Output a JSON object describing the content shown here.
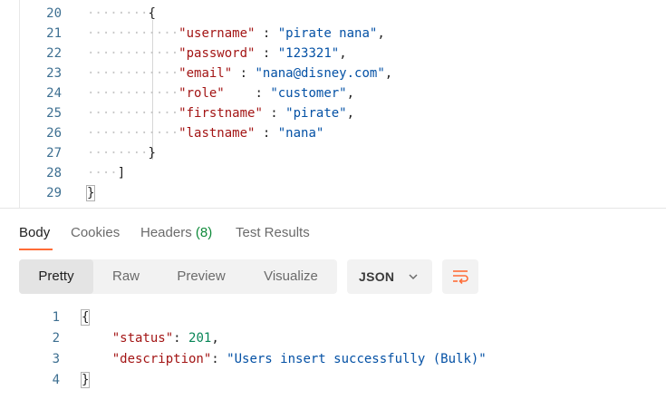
{
  "request_editor": {
    "lines": [
      {
        "n": "20",
        "indent": 8,
        "parts": [
          {
            "t": "{",
            "c": "p"
          }
        ]
      },
      {
        "n": "21",
        "indent": 12,
        "parts": [
          {
            "t": "\"username\"",
            "c": "k"
          },
          {
            "t": " : ",
            "c": "p"
          },
          {
            "t": "\"pirate nana\"",
            "c": "s"
          },
          {
            "t": ",",
            "c": "p"
          }
        ]
      },
      {
        "n": "22",
        "indent": 12,
        "parts": [
          {
            "t": "\"password\"",
            "c": "k"
          },
          {
            "t": " : ",
            "c": "p"
          },
          {
            "t": "\"123321\"",
            "c": "s"
          },
          {
            "t": ",",
            "c": "p"
          }
        ]
      },
      {
        "n": "23",
        "indent": 12,
        "parts": [
          {
            "t": "\"email\"",
            "c": "k"
          },
          {
            "t": " : ",
            "c": "p"
          },
          {
            "t": "\"nana@disney.com\"",
            "c": "s"
          },
          {
            "t": ",",
            "c": "p"
          }
        ]
      },
      {
        "n": "24",
        "indent": 12,
        "parts": [
          {
            "t": "\"role\"",
            "c": "k"
          },
          {
            "t": "    : ",
            "c": "p"
          },
          {
            "t": "\"customer\"",
            "c": "s"
          },
          {
            "t": ",",
            "c": "p"
          }
        ]
      },
      {
        "n": "25",
        "indent": 12,
        "parts": [
          {
            "t": "\"firstname\"",
            "c": "k"
          },
          {
            "t": " : ",
            "c": "p"
          },
          {
            "t": "\"pirate\"",
            "c": "s"
          },
          {
            "t": ",",
            "c": "p"
          }
        ]
      },
      {
        "n": "26",
        "indent": 12,
        "parts": [
          {
            "t": "\"lastname\"",
            "c": "k"
          },
          {
            "t": " : ",
            "c": "p"
          },
          {
            "t": "\"nana\"",
            "c": "s"
          }
        ]
      },
      {
        "n": "27",
        "indent": 8,
        "parts": [
          {
            "t": "}",
            "c": "p"
          }
        ]
      },
      {
        "n": "28",
        "indent": 4,
        "parts": [
          {
            "t": "]",
            "c": "p"
          }
        ]
      },
      {
        "n": "29",
        "indent": 0,
        "parts": [
          {
            "t": "}",
            "c": "p"
          }
        ]
      }
    ]
  },
  "response_tabs": [
    {
      "label": "Body",
      "badge": "",
      "active": true
    },
    {
      "label": "Cookies",
      "badge": "",
      "active": false
    },
    {
      "label": "Headers",
      "badge": "(8)",
      "active": false
    },
    {
      "label": "Test Results",
      "badge": "",
      "active": false
    }
  ],
  "view_modes": [
    {
      "label": "Pretty",
      "active": true
    },
    {
      "label": "Raw",
      "active": false
    },
    {
      "label": "Preview",
      "active": false
    },
    {
      "label": "Visualize",
      "active": false
    }
  ],
  "format_select": {
    "value": "JSON",
    "icon": "chevron-down-icon"
  },
  "wrap_button": {
    "icon": "wrap-lines-icon",
    "color": "#ff6c37"
  },
  "response_body": {
    "lines": [
      {
        "n": "1",
        "parts": [
          {
            "t": "{",
            "c": "p"
          }
        ]
      },
      {
        "n": "2",
        "parts": [
          {
            "t": "    ",
            "c": "p"
          },
          {
            "t": "\"status\"",
            "c": "k"
          },
          {
            "t": ": ",
            "c": "p"
          },
          {
            "t": "201",
            "c": "n"
          },
          {
            "t": ",",
            "c": "p"
          }
        ]
      },
      {
        "n": "3",
        "parts": [
          {
            "t": "    ",
            "c": "p"
          },
          {
            "t": "\"description\"",
            "c": "k"
          },
          {
            "t": ": ",
            "c": "p"
          },
          {
            "t": "\"Users insert successfully (Bulk)\"",
            "c": "s"
          }
        ]
      },
      {
        "n": "4",
        "parts": [
          {
            "t": "}",
            "c": "p"
          }
        ]
      }
    ]
  },
  "colors": {
    "accent": "#ff6c37",
    "json_key": "#a31515",
    "json_string": "#0451a5",
    "json_number": "#098658",
    "line_number": "#3d6f91",
    "badge": "#0f8a3a"
  }
}
